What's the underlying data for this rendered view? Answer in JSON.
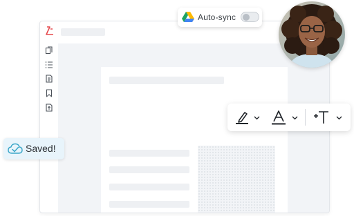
{
  "sync": {
    "label": "Auto-sync",
    "enabled": false,
    "icon": "google-drive-icon"
  },
  "toast": {
    "label": "Saved!",
    "icon": "cloud-check-icon"
  },
  "toolbar": {
    "tools": [
      "highlight-pen-icon",
      "text-color-icon",
      "add-text-icon"
    ]
  },
  "sidebar": {
    "icons": [
      "logo-icon",
      "pages-icon",
      "list-icon",
      "document-icon",
      "bookmark-icon",
      "export-icon"
    ]
  },
  "colors": {
    "brand_red": "#e5484d",
    "drive_green": "#1ea362",
    "drive_yellow": "#ffba00",
    "drive_blue": "#4285f4",
    "toast_bg": "#e8f4fb",
    "accent_teal": "#3aa6c8"
  }
}
